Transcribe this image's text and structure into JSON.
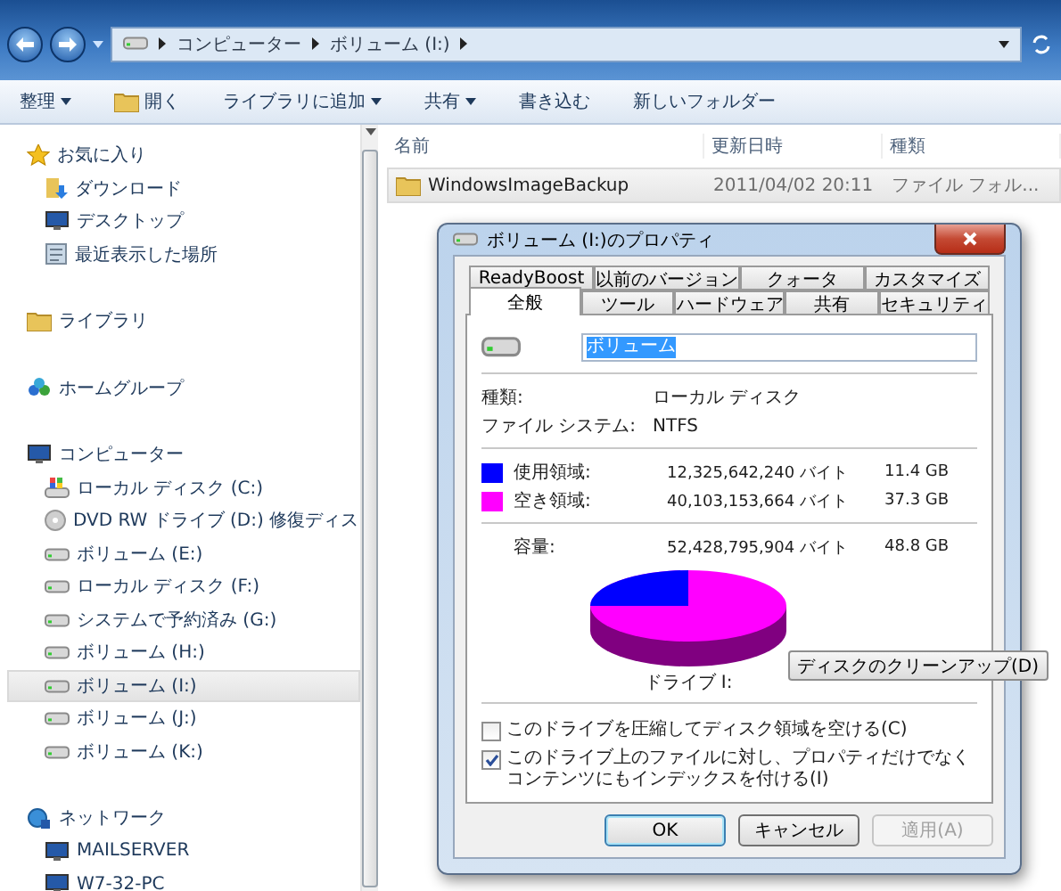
{
  "address": {
    "crumbs": [
      "コンピューター",
      "ボリューム (I:)"
    ]
  },
  "toolbar": [
    {
      "label": "整理",
      "kind": "menu"
    },
    {
      "label": "開く",
      "kind": "open"
    },
    {
      "label": "ライブラリに追加",
      "kind": "menu"
    },
    {
      "label": "共有",
      "kind": "menu"
    },
    {
      "label": "書き込む",
      "kind": "action"
    },
    {
      "label": "新しいフォルダー",
      "kind": "action"
    }
  ],
  "sidebar": [
    {
      "label": "お気に入り",
      "kind": "favorites",
      "items": [
        {
          "label": "ダウンロード",
          "kind": "download",
          "selected": false
        },
        {
          "label": "デスクトップ",
          "kind": "desktop",
          "selected": false
        },
        {
          "label": "最近表示した場所",
          "kind": "recent",
          "selected": false
        }
      ]
    },
    {
      "label": "ライブラリ",
      "kind": "libraries"
    },
    {
      "label": "ホームグループ",
      "kind": "homegroup"
    },
    {
      "label": "コンピューター",
      "kind": "computer",
      "items": [
        {
          "label": "ローカル ディスク (C:)",
          "kind": "system-drive",
          "selected": false
        },
        {
          "label": "DVD RW ドライブ (D:) 修復ディス",
          "kind": "dvd",
          "selected": false
        },
        {
          "label": "ボリューム (E:)",
          "kind": "drive",
          "selected": false
        },
        {
          "label": "ローカル ディスク (F:)",
          "kind": "drive",
          "selected": false
        },
        {
          "label": "システムで予約済み (G:)",
          "kind": "drive",
          "selected": false
        },
        {
          "label": "ボリューム (H:)",
          "kind": "drive",
          "selected": false
        },
        {
          "label": "ボリューム (I:)",
          "kind": "drive",
          "selected": true
        },
        {
          "label": "ボリューム (J:)",
          "kind": "drive",
          "selected": false
        },
        {
          "label": "ボリューム (K:)",
          "kind": "drive",
          "selected": false
        }
      ]
    },
    {
      "label": "ネットワーク",
      "kind": "network",
      "items": [
        {
          "label": "MAILSERVER",
          "kind": "pc",
          "selected": false
        },
        {
          "label": "W7-32-PC",
          "kind": "pc",
          "selected": false
        }
      ]
    }
  ],
  "files": {
    "columns": [
      "名前",
      "更新日時",
      "種類"
    ],
    "rows": [
      {
        "cells": [
          "WindowsImageBackup",
          "2011/04/02 20:11",
          "ファイル フォル..."
        ],
        "selected": true
      }
    ]
  },
  "dialog": {
    "title": "ボリューム (I:)のプロパティ",
    "tab_rows": [
      [
        {
          "label": "ReadyBoost",
          "selected": false
        },
        {
          "label": "以前のバージョン",
          "selected": false
        },
        {
          "label": "クォータ",
          "selected": false
        },
        {
          "label": "カスタマイズ",
          "selected": false
        }
      ],
      [
        {
          "label": "全般",
          "selected": true
        },
        {
          "label": "ツール",
          "selected": false
        },
        {
          "label": "ハードウェア",
          "selected": false
        },
        {
          "label": "共有",
          "selected": false
        },
        {
          "label": "セキュリティ",
          "selected": false
        }
      ]
    ],
    "name_field": {
      "value": "ボリューム"
    },
    "info": [
      {
        "label": "種類:",
        "value": "ローカル ディスク"
      },
      {
        "label": "ファイル システム:",
        "value": "NTFS"
      }
    ],
    "usage": [
      {
        "label": "使用領域:",
        "bytes": "12,325,642,240 バイト",
        "size": "11.4 GB",
        "color": "#0000ff"
      },
      {
        "label": "空き領域:",
        "bytes": "40,103,153,664 バイト",
        "size": "37.3 GB",
        "color": "#ff00ff"
      }
    ],
    "capacity": {
      "label": "容量:",
      "bytes": "52,428,795,904 バイト",
      "size": "48.8 GB"
    },
    "drive_label": "ドライブ I:",
    "cleanup_button": "ディスクのクリーンアップ(D)",
    "options": [
      {
        "label": "このドライブを圧縮してディスク領域を空ける(C)",
        "checked": false
      },
      {
        "label": "このドライブ上のファイルに対し、プロパティだけでなくコンテンツにもインデックスを付ける(I)",
        "checked": true
      }
    ],
    "buttons": [
      {
        "label": "OK",
        "disabled": false,
        "default": true
      },
      {
        "label": "キャンセル",
        "disabled": false,
        "default": false
      },
      {
        "label": "適用(A)",
        "disabled": true,
        "default": false
      }
    ]
  }
}
